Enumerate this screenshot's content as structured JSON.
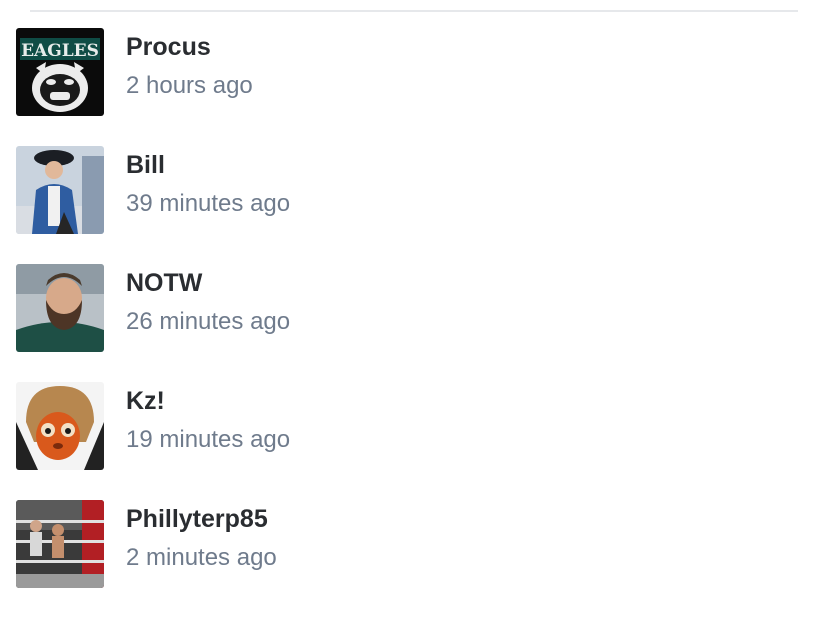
{
  "comments": [
    {
      "user": "Procus",
      "time": "2 hours ago",
      "avatar_icon": "eagles-bulldog-logo-avatar"
    },
    {
      "user": "Bill",
      "time": "39 minutes ago",
      "avatar_icon": "colonial-soldier-avatar"
    },
    {
      "user": "NOTW",
      "time": "26 minutes ago",
      "avatar_icon": "bearded-man-avatar"
    },
    {
      "user": "Kz!",
      "time": "19 minutes ago",
      "avatar_icon": "cartoon-face-avatar"
    },
    {
      "user": "Phillyterp85",
      "time": "2 minutes ago",
      "avatar_icon": "boxing-ring-avatar"
    }
  ],
  "colors": {
    "name": "#2a2d31",
    "timestamp": "#6f7b8c",
    "divider": "#e6e8eb"
  }
}
